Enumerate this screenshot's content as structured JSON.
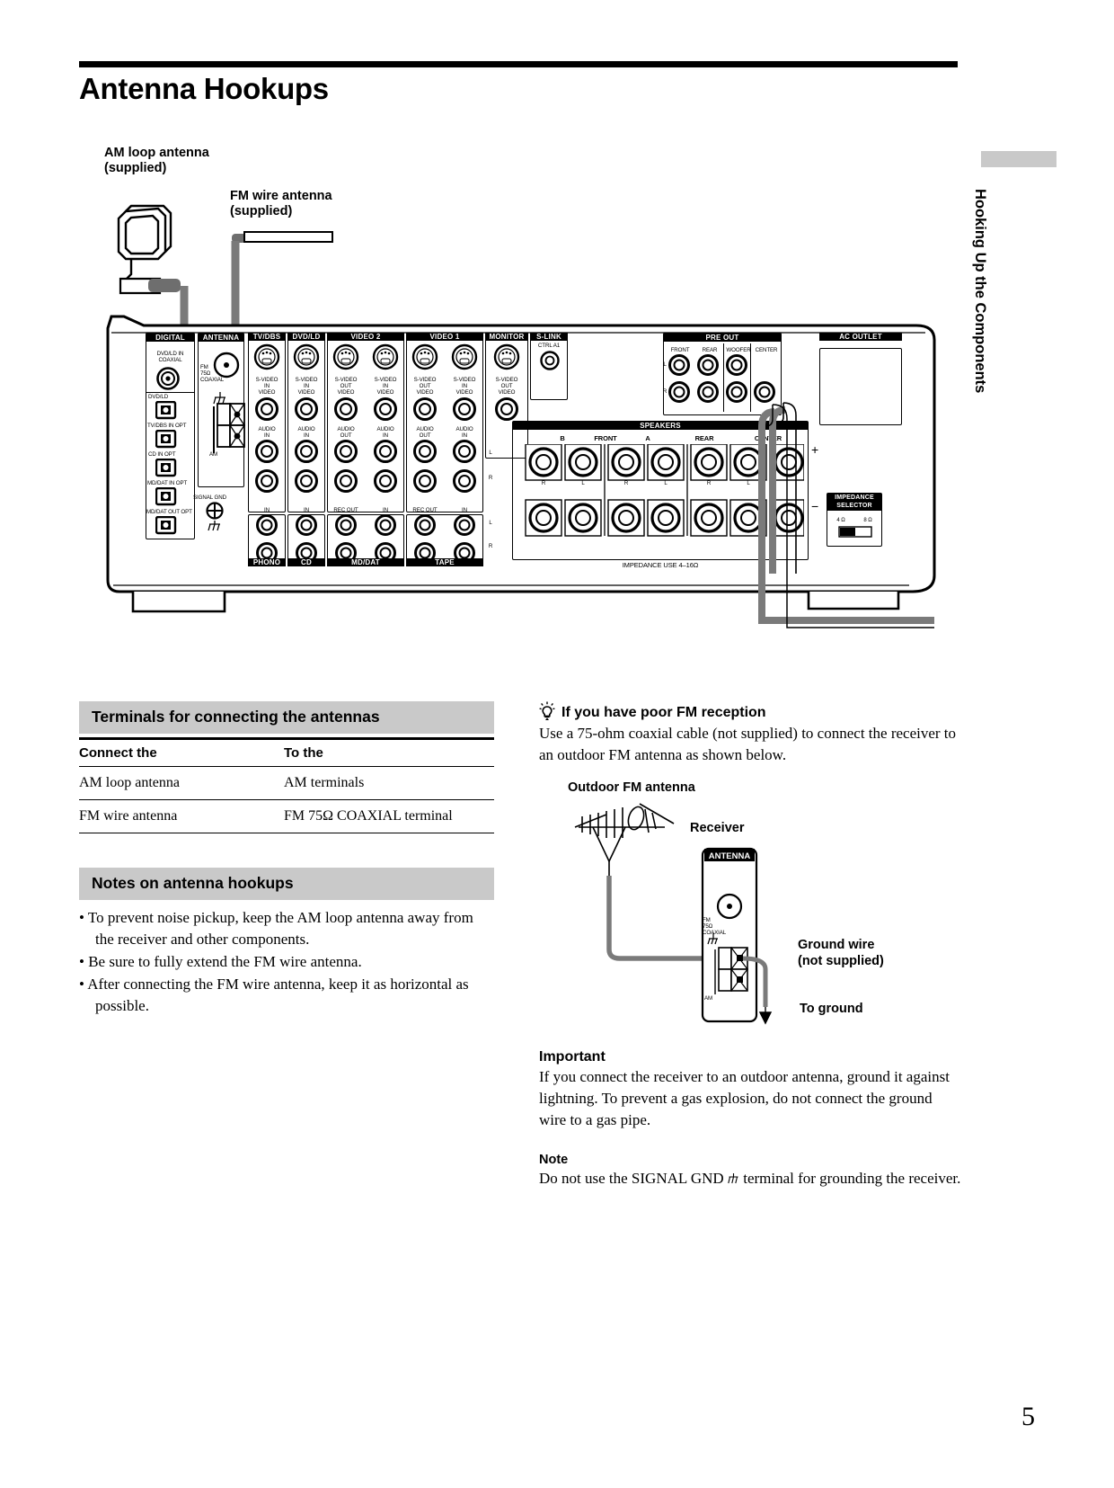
{
  "page": {
    "title": "Antenna Hookups",
    "number": "5",
    "side_tab": "Hooking Up the Components"
  },
  "callouts": {
    "am_loop": "AM loop antenna\n(supplied)",
    "fm_wire": "FM wire antenna\n(supplied)"
  },
  "rear_panel": {
    "groups": {
      "digital": "DIGITAL",
      "antenna": "ANTENNA",
      "tv_dbs": "TV/DBS",
      "dvd_ld": "DVD/LD",
      "video2": "VIDEO 2",
      "video1": "VIDEO 1",
      "monitor": "MONITOR",
      "slink": "S-LINK",
      "pre_out": "PRE  OUT",
      "speakers": "SPEAKERS",
      "ac_outlet": "AC OUTLET"
    },
    "digital_jacks": [
      "DVD/LD IN\nCOAXIAL",
      "DVD/LD",
      "TV/DBS IN OPT",
      "CD IN OPT",
      "MD/DAT IN OPT",
      "MD/DAT  OUT OPT"
    ],
    "antenna_jacks": {
      "fm": "FM\n75Ω\nCOAXIAL",
      "am": "AM",
      "signal_gnd": "SIGNAL GND"
    },
    "slink": "CTRL A1",
    "video_columns": [
      {
        "group": "TV/DBS",
        "jacks": [
          "S-VIDEO",
          "IN",
          "VIDEO",
          "AUDIO",
          "IN"
        ],
        "bottom": "IN"
      },
      {
        "group": "DVD/LD",
        "jacks": [
          "S-VIDEO",
          "IN",
          "VIDEO",
          "AUDIO",
          "IN"
        ],
        "bottom": "IN"
      },
      {
        "group": "VIDEO 2",
        "jacks": [
          "S-VIDEO",
          "OUT",
          "VIDEO",
          "AUDIO",
          "OUT"
        ],
        "bottom": "REC OUT"
      },
      {
        "group": "VIDEO 2",
        "jacks": [
          "S-VIDEO",
          "IN",
          "VIDEO",
          "AUDIO",
          "IN"
        ],
        "bottom": "IN"
      },
      {
        "group": "VIDEO 1",
        "jacks": [
          "S-VIDEO",
          "OUT",
          "VIDEO",
          "AUDIO",
          "OUT"
        ],
        "bottom": "REC OUT"
      },
      {
        "group": "VIDEO 1",
        "jacks": [
          "S-VIDEO",
          "IN",
          "VIDEO",
          "AUDIO",
          "IN"
        ],
        "bottom": "IN"
      },
      {
        "group": "MONITOR",
        "jacks": [
          "S-VIDEO",
          "OUT",
          "VIDEO"
        ],
        "bottom": ""
      }
    ],
    "audio_bottom_labels": [
      "PHONO",
      "CD",
      "MD/DAT",
      "TAPE"
    ],
    "pre_out_labels": [
      "FRONT",
      "REAR",
      "WOOFER",
      "CENTER"
    ],
    "speaker_labels": [
      "B",
      "FRONT",
      "A",
      "REAR",
      "CENTER"
    ],
    "speaker_lr": [
      "R",
      "L",
      "R",
      "L",
      "R",
      "L",
      ""
    ],
    "impedance_selector": "IMPEDANCE\nSELECTOR",
    "impedance_values": [
      "4 Ω",
      "8 Ω"
    ],
    "impedance_use": "IMPEDANCE  USE  4–16Ω",
    "lr_marks": [
      "L",
      "R"
    ],
    "plus": "+",
    "minus": "−"
  },
  "terminals_section": {
    "heading": "Terminals for connecting the antennas",
    "columns": [
      "Connect the",
      "To the"
    ],
    "rows": [
      [
        "AM loop antenna",
        "AM terminals"
      ],
      [
        "FM wire antenna",
        "FM 75Ω COAXIAL terminal"
      ]
    ]
  },
  "notes_section": {
    "heading": "Notes on antenna hookups",
    "items": [
      "To prevent noise pickup, keep the AM loop antenna away from the receiver and other components.",
      "Be sure to fully extend the FM wire antenna.",
      "After connecting the FM wire antenna, keep it as horizontal as possible."
    ]
  },
  "tip_section": {
    "heading": "If you have poor FM reception",
    "body": "Use a 75-ohm coaxial cable (not supplied) to connect the receiver to an outdoor FM antenna as shown below."
  },
  "fm_diagram": {
    "outdoor_antenna": "Outdoor FM antenna",
    "receiver": "Receiver",
    "antenna_header": "ANTENNA",
    "fm_jack": "FM\n75Ω\nCOAXIAL",
    "am_jack": "AM",
    "ground_wire": "Ground wire\n(not supplied)",
    "to_ground": "To ground"
  },
  "important_section": {
    "heading": "Important",
    "body": "If you connect the receiver to an outdoor antenna, ground it against lightning.  To prevent a gas explosion, do not connect the ground wire to a gas pipe."
  },
  "note_section": {
    "heading": "Note",
    "body_before": "Do not use the SIGNAL GND",
    "body_after": "terminal for grounding the receiver."
  }
}
